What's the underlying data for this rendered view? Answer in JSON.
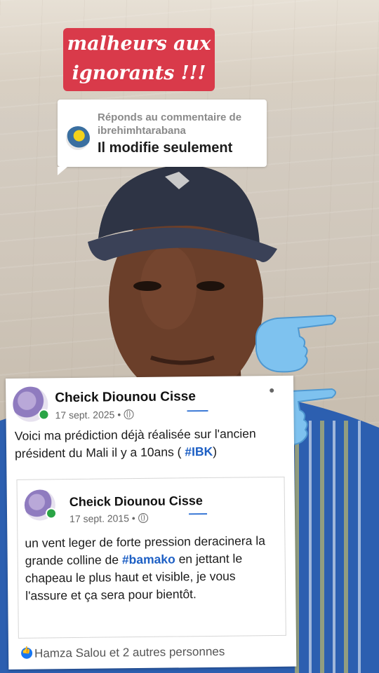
{
  "overlay": {
    "title_line1": "malheurs aux",
    "title_line2": "ignorants !!!"
  },
  "reply_card": {
    "reply_to_line1": "Réponds au commentaire de",
    "reply_to_line2": "ibrehimhtarabana",
    "comment": "Il modifie seulement"
  },
  "post": {
    "author": "Cheick Diounou Cisse",
    "date": "17 sept. 2025",
    "separator": "•",
    "text_part1": "Voici ma prédiction déjà réalisée sur l'ancien président du Mali il y a 10ans (",
    "hashtag": "#IBK",
    "text_part2": ")",
    "shared": {
      "author": "Cheick Diounou Cisse",
      "date": "17 sept. 2015",
      "separator": "•",
      "text_part1": "un vent leger de forte pression deracinera la grande colline de",
      "hashtag": "#bamako",
      "text_part2": "en jettant le chapeau le plus haut et visible, je vous l'assure et ça sera pour bientôt."
    },
    "reactions": "Hamza Salou et 2 autres personnes"
  },
  "icons": [
    "like-icon",
    "globe-icon",
    "pointing-hand-icon",
    "more-options-icon"
  ]
}
